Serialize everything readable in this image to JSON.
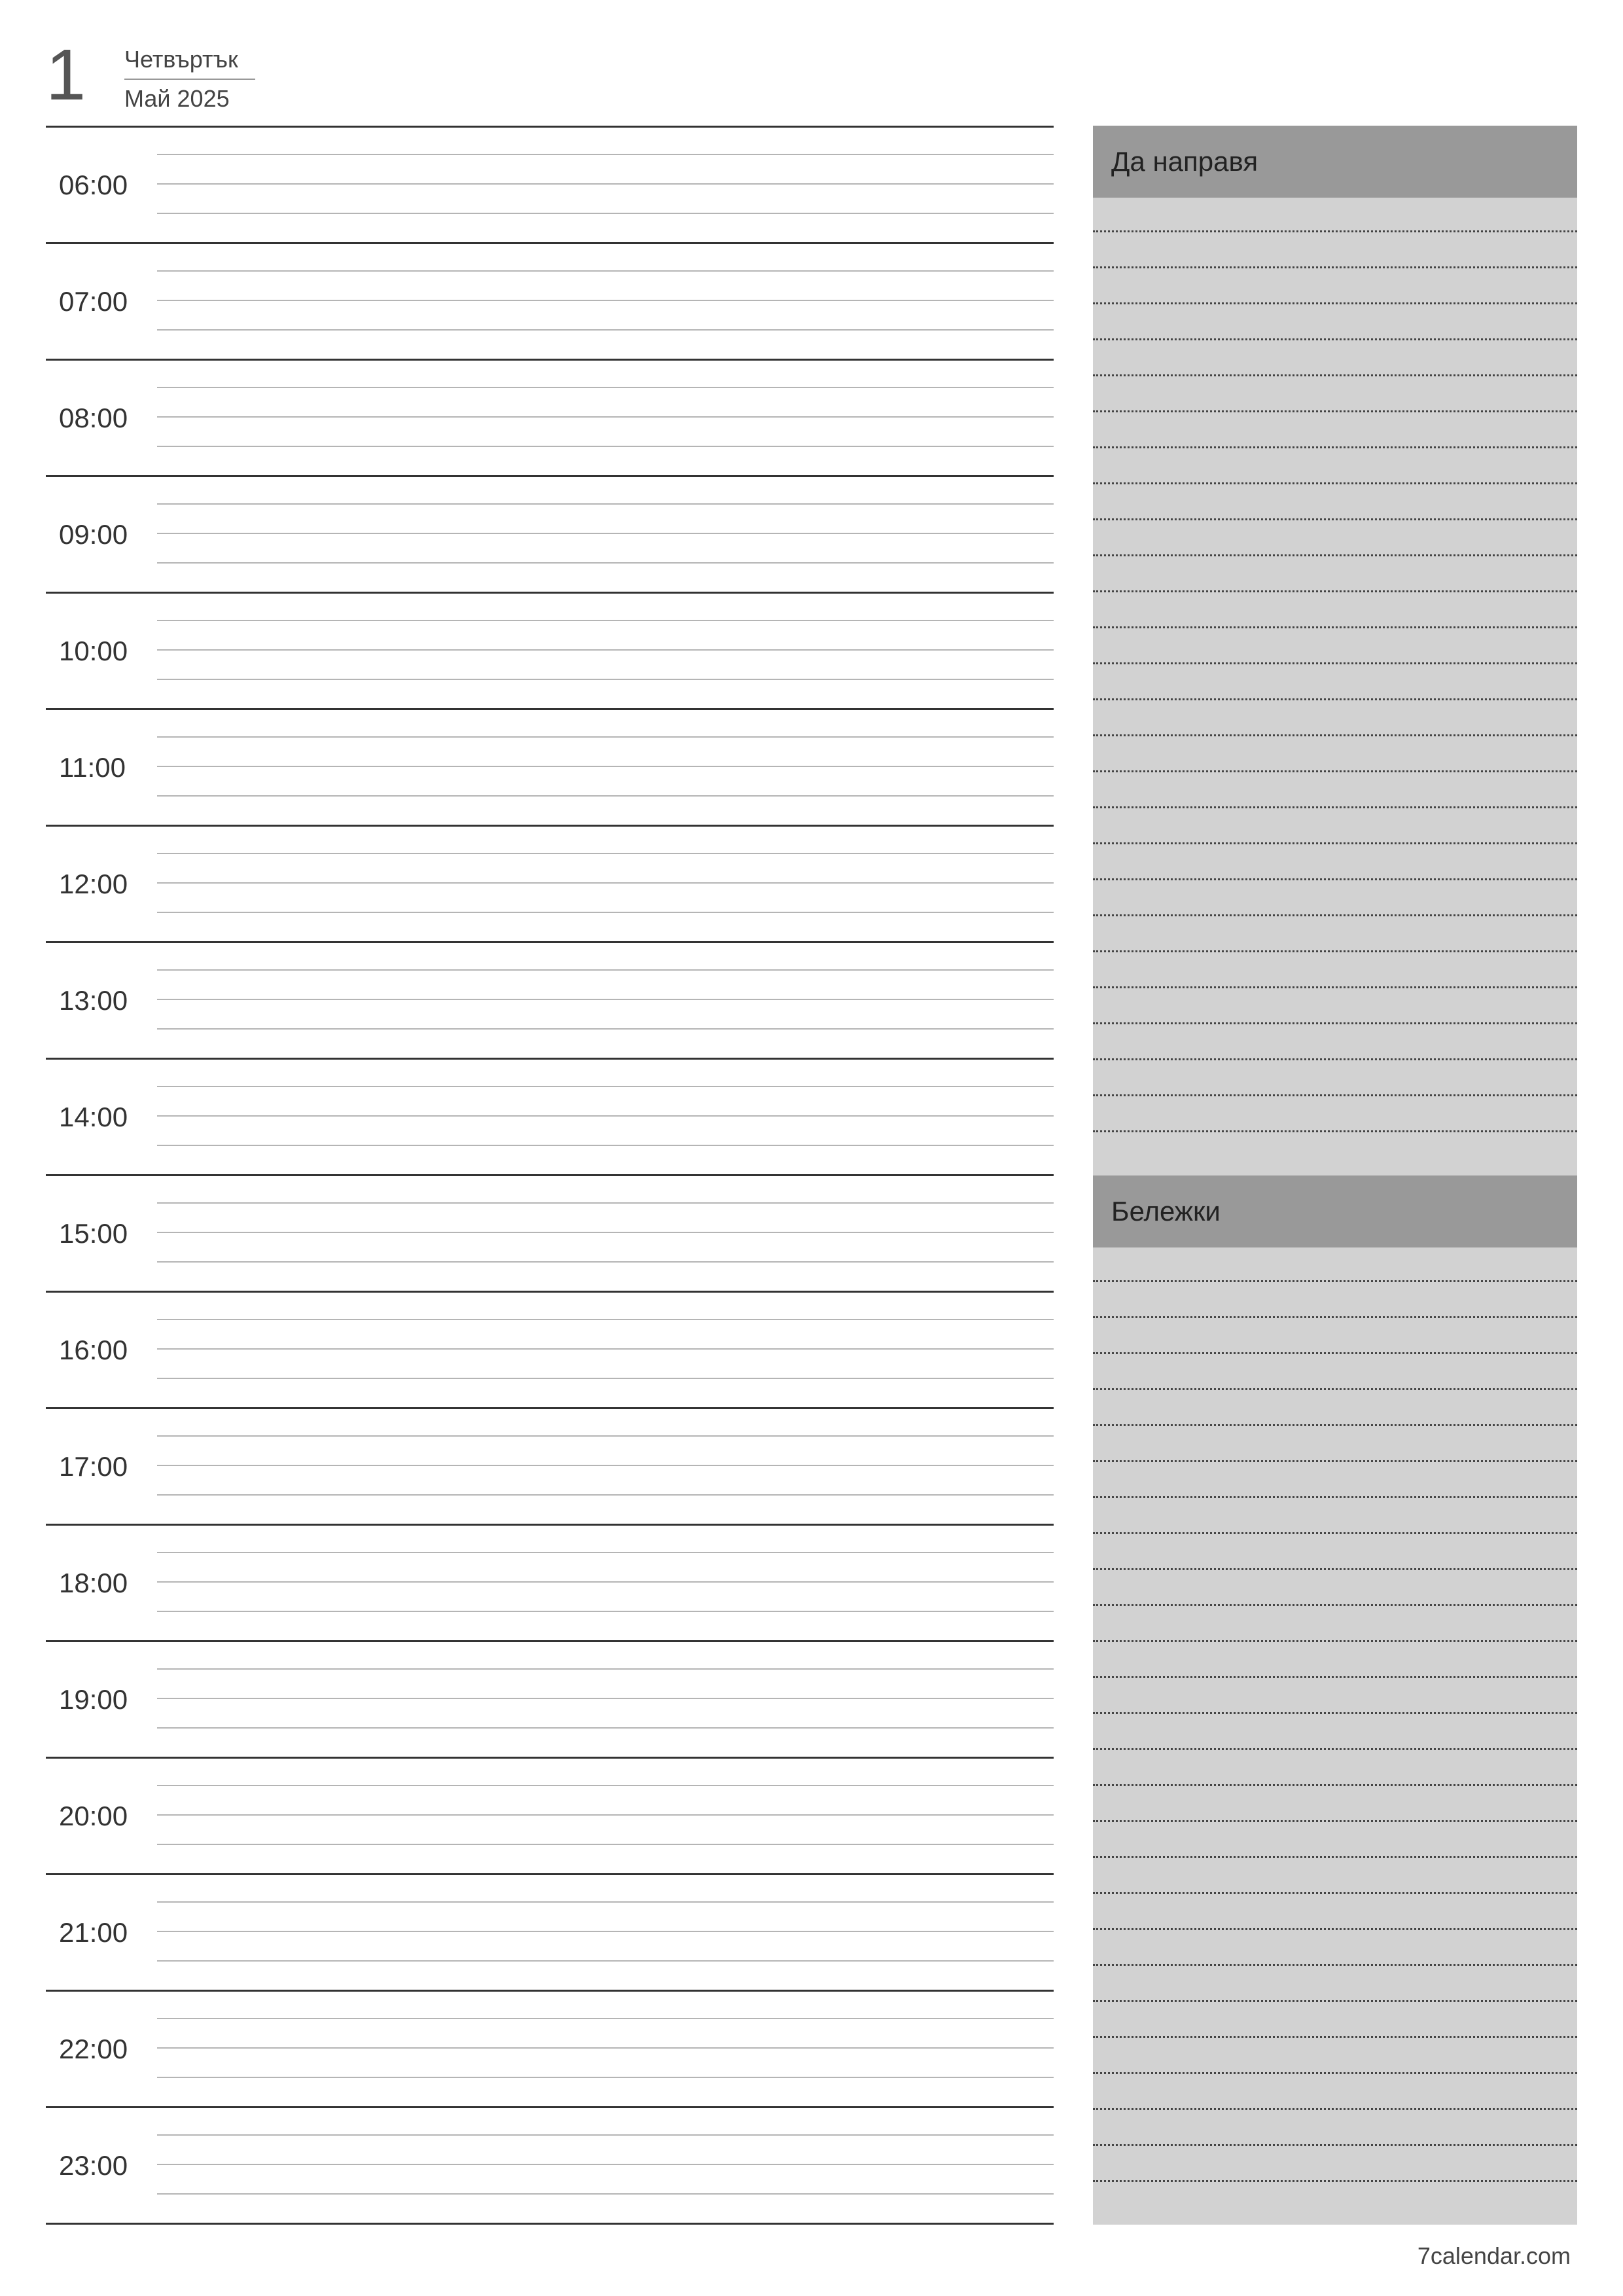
{
  "header": {
    "day": "1",
    "weekday": "Четвъртък",
    "month_year": "Май 2025"
  },
  "hours": [
    "06:00",
    "07:00",
    "08:00",
    "09:00",
    "10:00",
    "11:00",
    "12:00",
    "13:00",
    "14:00",
    "15:00",
    "16:00",
    "17:00",
    "18:00",
    "19:00",
    "20:00",
    "21:00",
    "22:00",
    "23:00"
  ],
  "side": {
    "todo_title": "Да направя",
    "notes_title": "Бележки"
  },
  "footer": "7calendar.com"
}
